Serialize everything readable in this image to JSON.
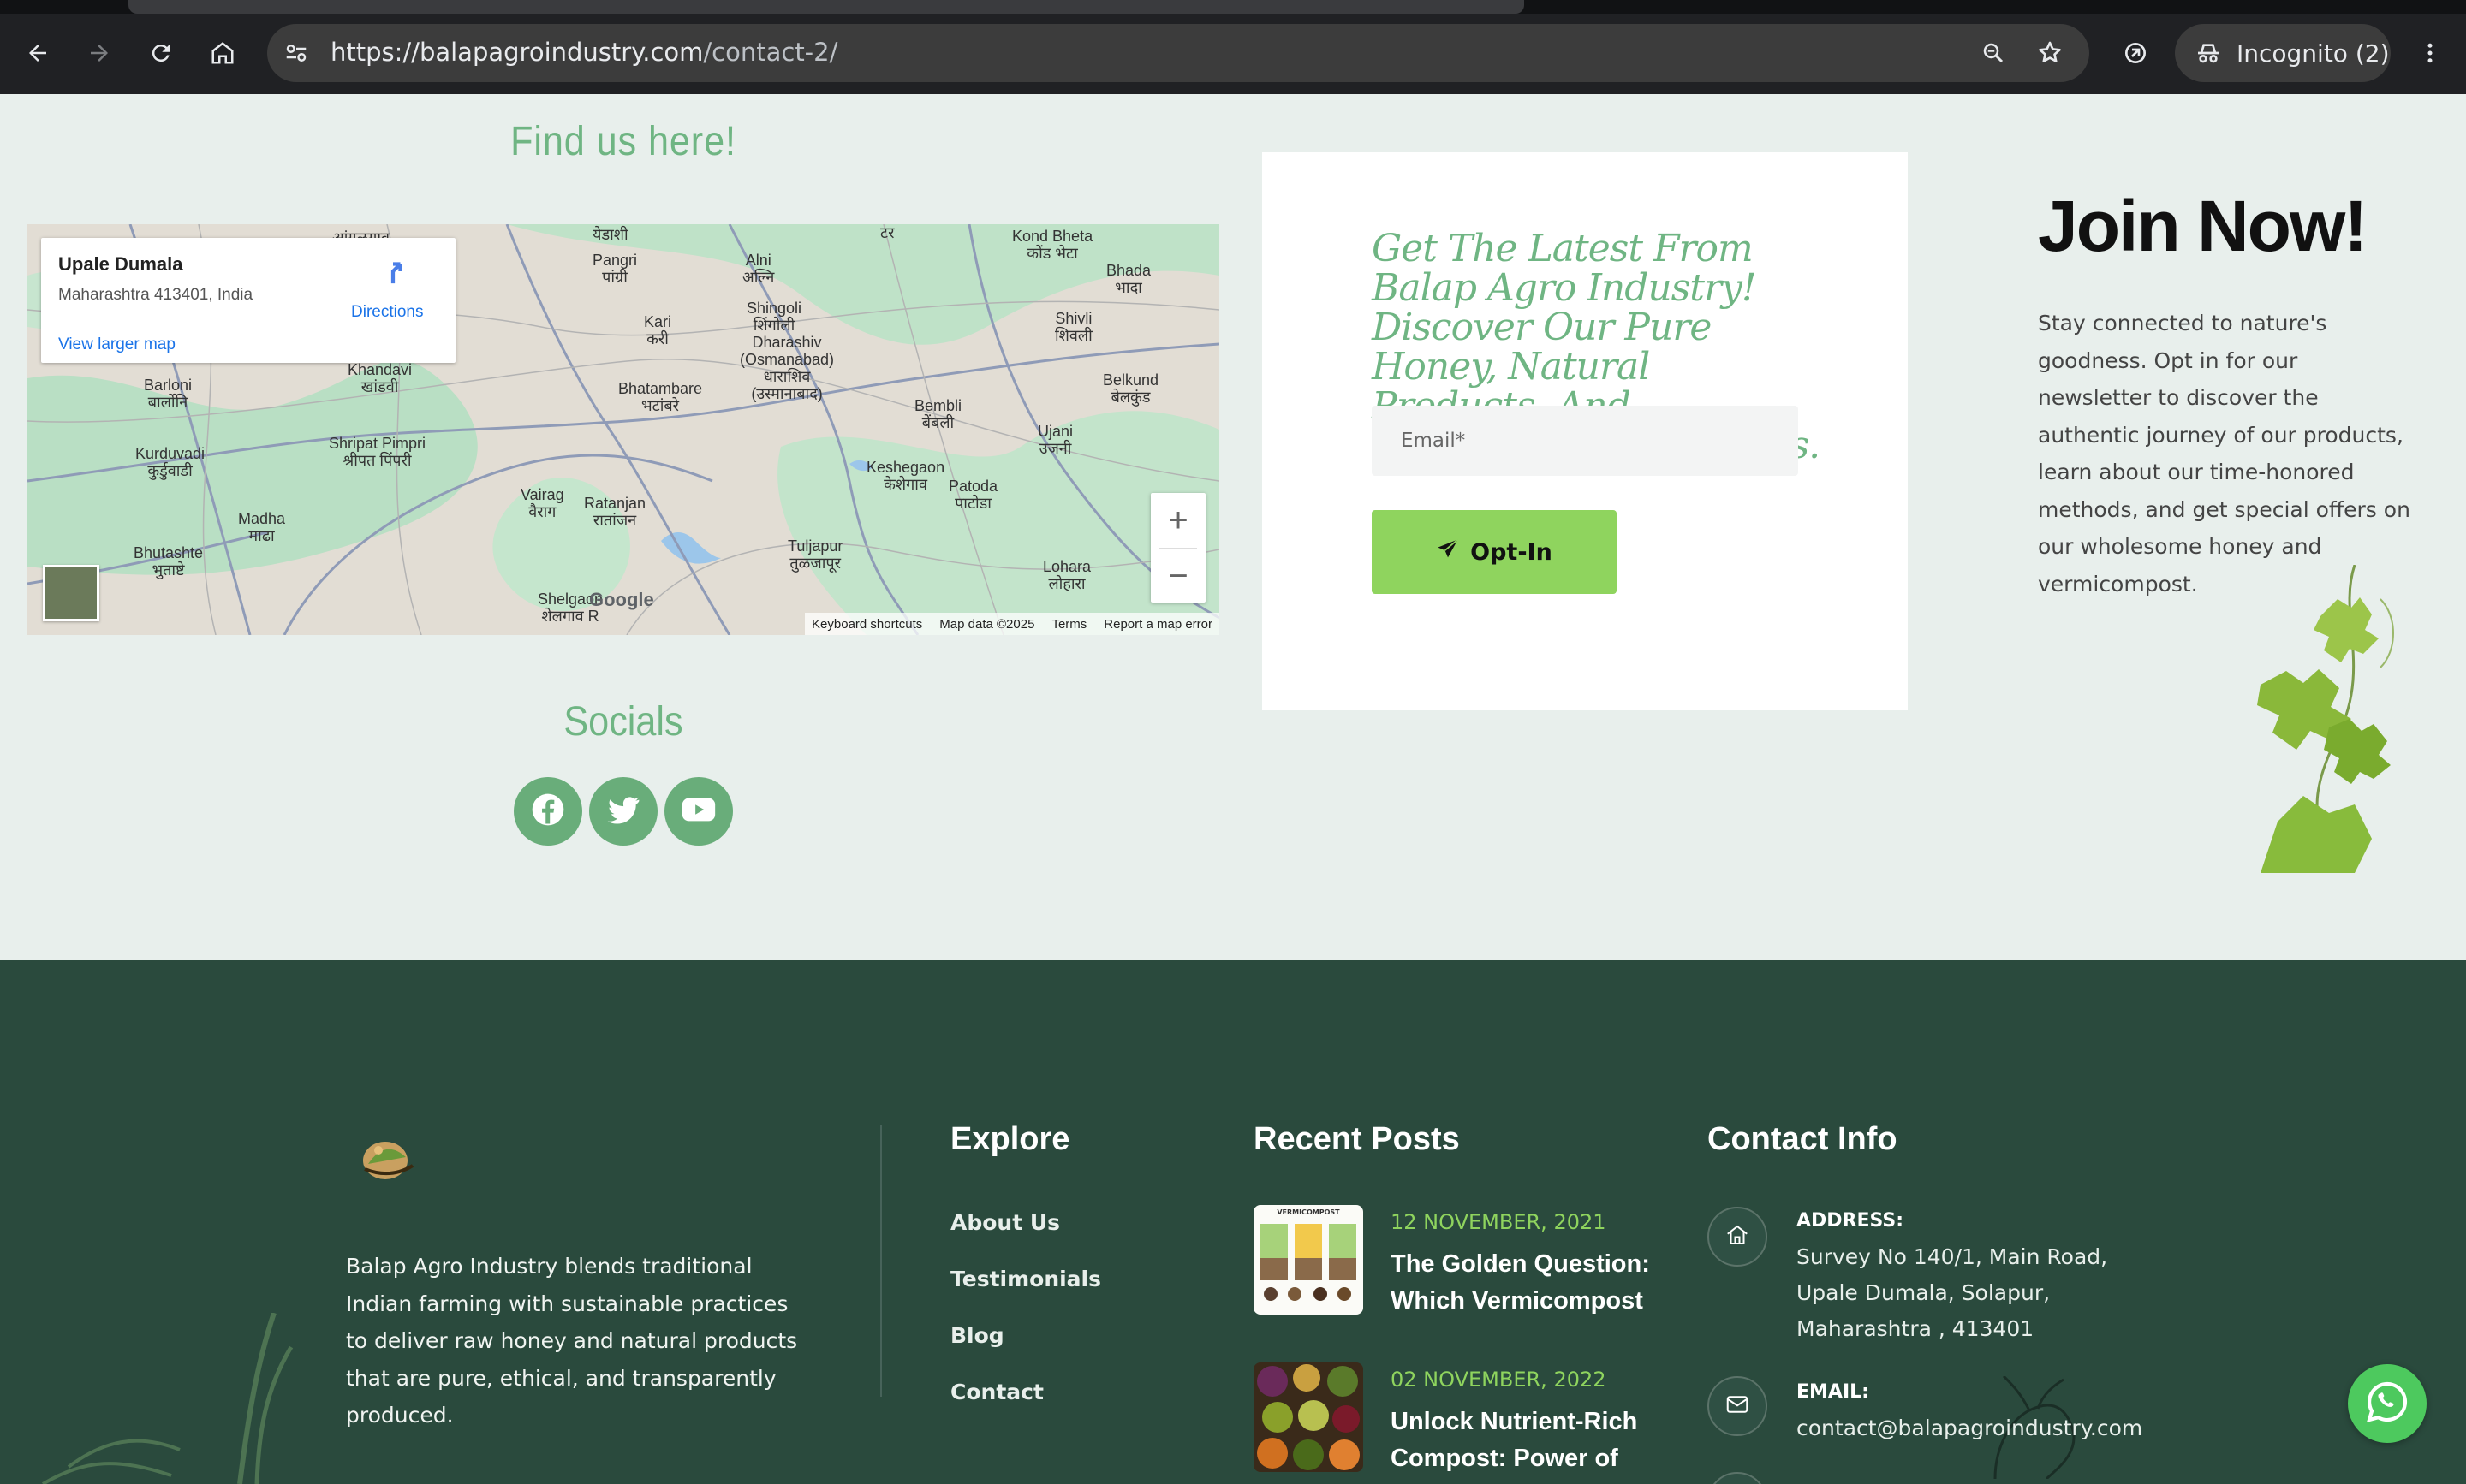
{
  "browser": {
    "url_host": "https://balapagroindustry.com",
    "url_path": "/contact-2/",
    "incognito_label": "Incognito (2)"
  },
  "find_us": {
    "title": "Find us here!",
    "map": {
      "place_name": "Upale Dumala",
      "place_address": "Maharashtra 413401, India",
      "directions_label": "Directions",
      "larger_map_label": "View larger map",
      "zoom_in": "+",
      "zoom_out": "−",
      "footer": [
        "Keyboard shortcuts",
        "Map data ©2025",
        "Terms",
        "Report a map error"
      ],
      "google_label": "Google"
    }
  },
  "socials": {
    "title": "Socials",
    "items": [
      "facebook-icon",
      "twitter-icon",
      "youtube-icon"
    ]
  },
  "newsletter": {
    "heading": "Get The Latest From Balap Agro Industry! Discover Our Pure Honey, Natural Products, And Sustainable Farm News.",
    "email_placeholder": "Email*",
    "button_label": "Opt-In"
  },
  "join": {
    "title": "Join Now!",
    "text_1": "Stay connected to nature's goodness. Opt in for our newsletter to discover the authentic journey of our products, learn about our time-honored methods, and get special offers on",
    "text_2": "our wholesome honey and vermicompost."
  },
  "footer": {
    "about": "Balap Agro Industry blends traditional Indian farming with sustainable practices to deliver raw honey and natural products that are pure, ethical, and transparently produced.",
    "explore": {
      "title": "Explore",
      "links": [
        "About Us",
        "Testimonials",
        "Blog",
        "Contact"
      ]
    },
    "recent_posts": {
      "title": "Recent Posts",
      "posts": [
        {
          "date": "12 NOVEMBER, 2021",
          "title": "The Golden Question: Which Vermicompost",
          "thumb_label": "VERMICOMPOST"
        },
        {
          "date": "02 NOVEMBER, 2022",
          "title": "Unlock Nutrient-Rich Compost: Power of"
        }
      ]
    },
    "contact": {
      "title": "Contact Info",
      "address_label": "ADDRESS:",
      "address_value": "Survey No 140/1, Main Road, Upale Dumala, Solapur, Maharashtra , 413401",
      "email_label": "EMAIL:",
      "email_value": "contact@balapagroindustry.com"
    }
  },
  "colors": {
    "accent_green": "#6fb583",
    "button_green": "#8fd45e",
    "footer_bg": "#2a4a3d",
    "page_bg": "#e8efec"
  }
}
